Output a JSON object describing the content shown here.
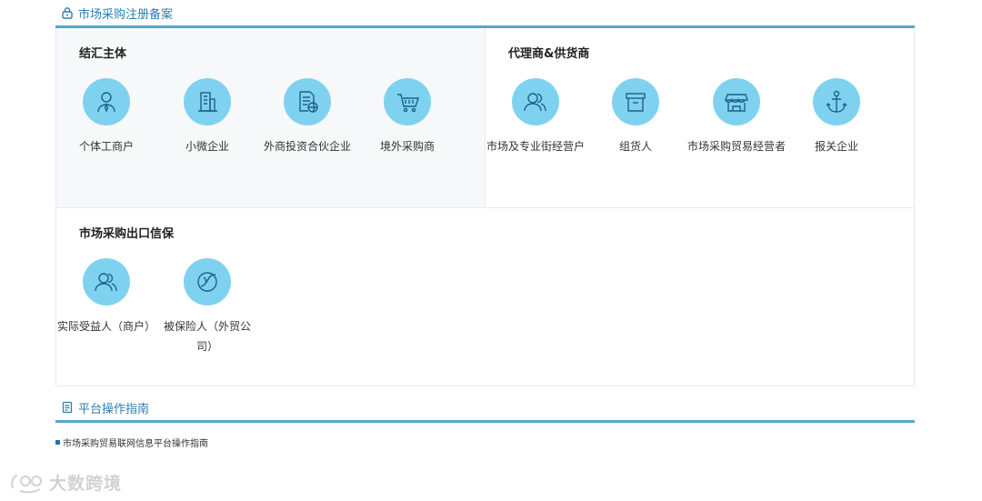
{
  "section_register": {
    "title": "市场采购注册备案"
  },
  "groups": [
    {
      "title": "结汇主体",
      "items": [
        {
          "label": "个体工商户",
          "icon": "person-tie-icon"
        },
        {
          "label": "小微企业",
          "icon": "building-icon"
        },
        {
          "label": "外商投资合伙企业",
          "icon": "document-globe-icon"
        },
        {
          "label": "境外采购商",
          "icon": "shopping-cart-icon"
        }
      ]
    },
    {
      "title": "代理商&供货商",
      "items": [
        {
          "label": "市场及专业街经营户",
          "icon": "users-icon"
        },
        {
          "label": "组货人",
          "icon": "archive-box-icon"
        },
        {
          "label": "市场采购贸易经营者",
          "icon": "storefront-icon"
        },
        {
          "label": "报关企业",
          "icon": "anchor-icon"
        }
      ]
    },
    {
      "title": "市场采购出口信保",
      "items": [
        {
          "label": "实际受益人（商户）",
          "icon": "users-icon"
        },
        {
          "label": "被保险人（外贸公司）",
          "icon": "globe-leaf-icon"
        }
      ]
    }
  ],
  "section_guide": {
    "title": "平台操作指南",
    "link": "市场采购贸易联网信息平台操作指南"
  },
  "watermark": {
    "text": "大数跨境"
  },
  "colors": {
    "accent": "#5aa6c8",
    "circle": "#7fd2ef",
    "icon_stroke": "#1f5f8a"
  }
}
